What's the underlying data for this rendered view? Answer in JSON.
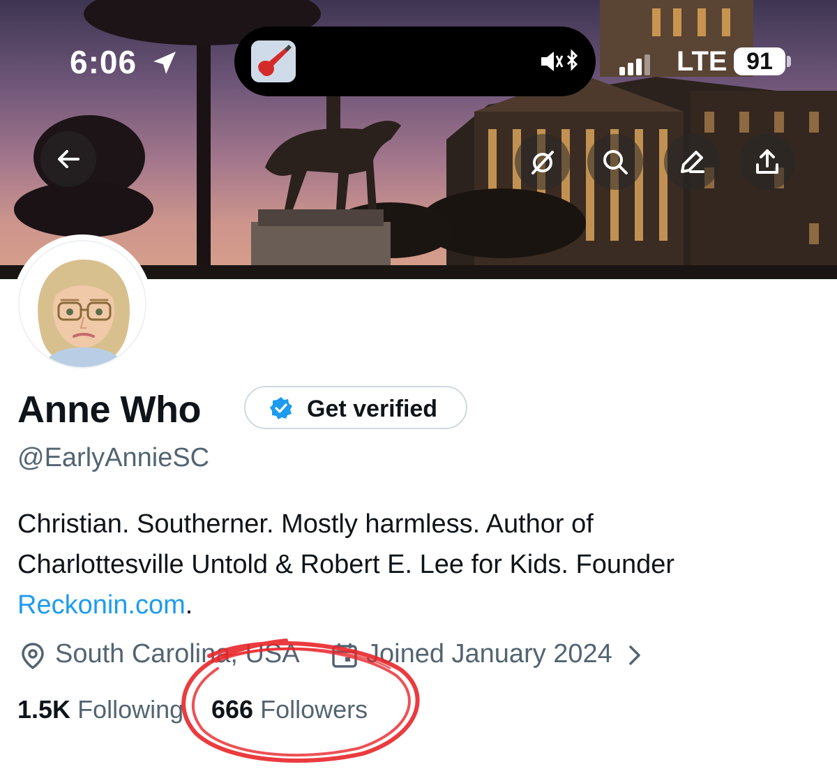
{
  "status_bar": {
    "time": "6:06",
    "network": "LTE",
    "battery": "91"
  },
  "header": {
    "buttons": [
      "back",
      "grok",
      "search",
      "edit",
      "share"
    ]
  },
  "profile": {
    "name": "Anne Who",
    "get_verified_label": "Get verified",
    "handle": "@EarlyAnnieSC",
    "bio_line1": "Christian. Southerner. Mostly harmless. Author of",
    "bio_line2": "Charlottesville Untold & Robert E. Lee for Kids. Founder",
    "bio_link": "Reckonin.com",
    "bio_link_suffix": ".",
    "location": "South Carolina, USA",
    "joined": "Joined January 2024",
    "following_count": "1.5K",
    "following_label": "Following",
    "followers_count": "666",
    "followers_label": "Followers"
  },
  "colors": {
    "accent": "#1d9bf0",
    "text_primary": "#0f1419",
    "text_secondary": "#536471",
    "annotation": "#e8262a"
  }
}
